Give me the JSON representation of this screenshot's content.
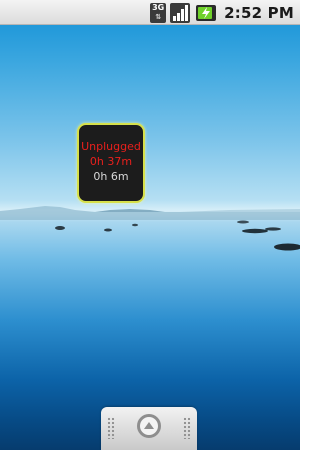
{
  "status_bar": {
    "network_type": "3G",
    "time": "2:52 PM",
    "battery_level": 0.85,
    "icons": [
      "network-3g-icon",
      "signal-strength-icon",
      "battery-charging-icon"
    ]
  },
  "widget": {
    "status": "Unplugged",
    "time_unplugged": "0h 37m",
    "time_remaining": "0h 6m"
  },
  "launcher": {
    "icon": "app-drawer-arrow-icon"
  },
  "colors": {
    "widget_text_alert": "#e8201c",
    "widget_border": "#d7e04a",
    "battery_fill": "#6fd12a"
  }
}
